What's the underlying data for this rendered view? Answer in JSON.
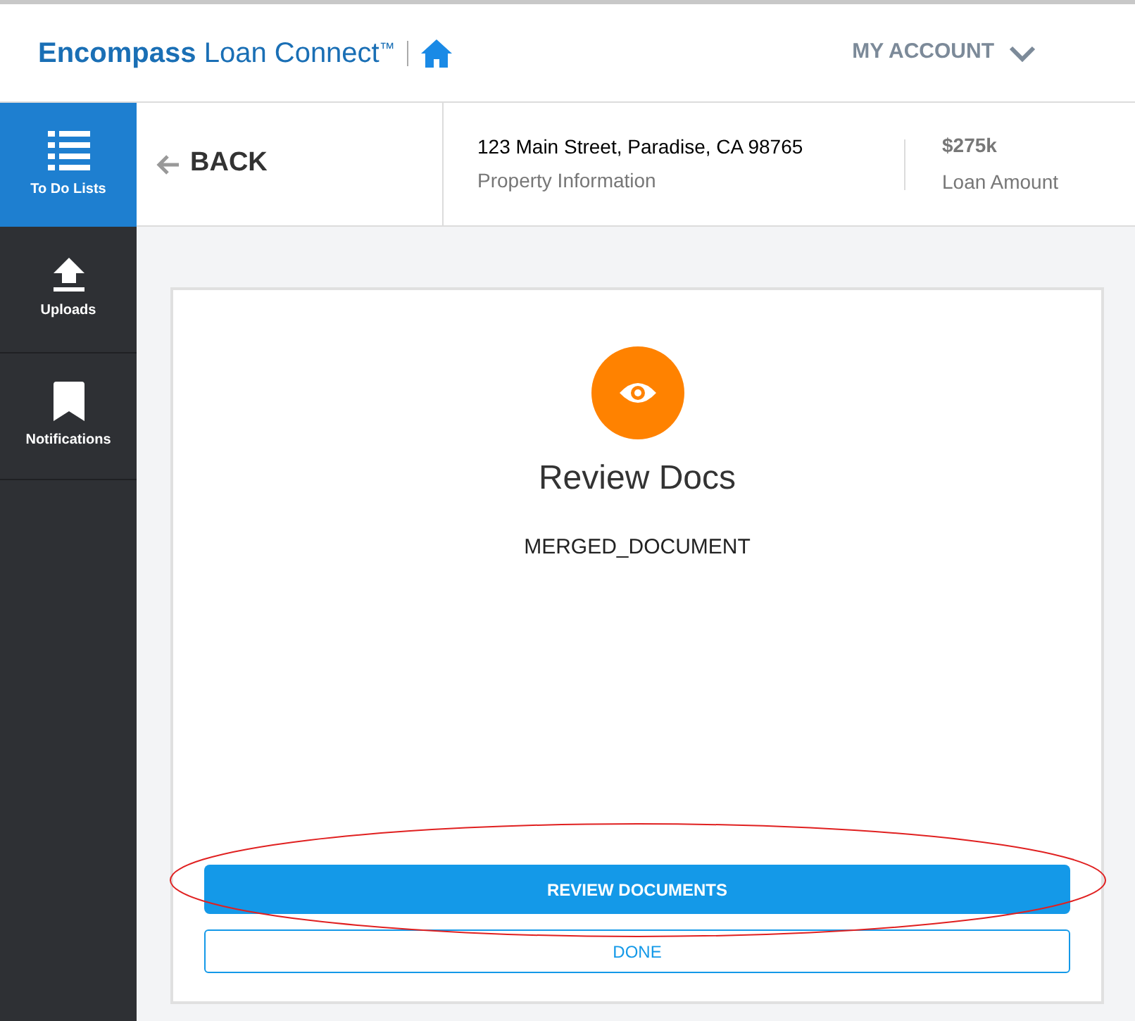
{
  "header": {
    "brand": {
      "name": "Encompass",
      "product": "Loan Connect",
      "mark": "™"
    },
    "account_menu": "MY ACCOUNT"
  },
  "sidebar": {
    "items": [
      {
        "kind": "list",
        "label": "To Do Lists",
        "selected": true
      },
      {
        "kind": "upload",
        "label": "Uploads",
        "selected": false
      },
      {
        "kind": "bookmark",
        "label": "Notifications",
        "selected": false
      }
    ]
  },
  "subheader": {
    "back": "BACK",
    "property": {
      "value": "123 Main Street, Paradise, CA 98765",
      "label": "Property Information"
    },
    "loan": {
      "value": "$275k",
      "label": "Loan Amount"
    }
  },
  "task": {
    "title": "Review Docs",
    "document": "MERGED_DOCUMENT",
    "buttons": [
      {
        "kind": "primary",
        "label": "REVIEW DOCUMENTS"
      },
      {
        "kind": "outline",
        "label": "DONE"
      }
    ]
  }
}
